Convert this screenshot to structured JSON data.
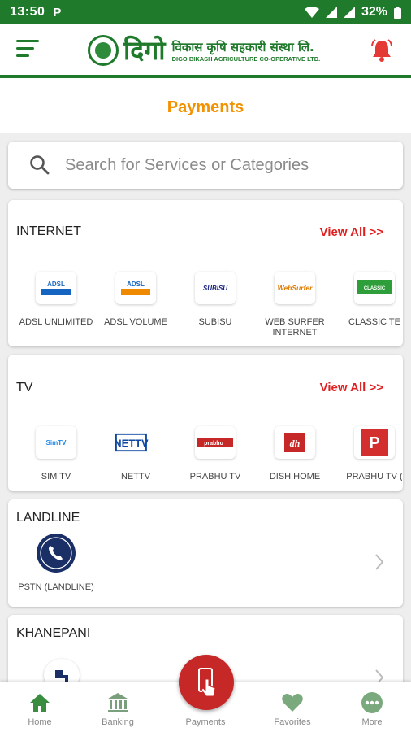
{
  "status_bar": {
    "time": "13:50",
    "app_badge": "P",
    "battery": "32%"
  },
  "header": {
    "logo_big": "दिगो",
    "logo_line1": "विकास कृषि सहकारी संस्था लि.",
    "logo_line2": "DIGO BIKASH AGRICULTURE CO-OPERATIVE LTD."
  },
  "page": {
    "title": "Payments"
  },
  "search": {
    "placeholder": "Search for Services or Categories"
  },
  "sections": {
    "internet": {
      "title": "INTERNET",
      "view_all": "View All >>",
      "items": [
        {
          "label": "ADSL UNLIMITED",
          "logo_text": "ADSL"
        },
        {
          "label": "ADSL VOLUME",
          "logo_text": "ADSL"
        },
        {
          "label": "SUBISU",
          "logo_text": "SUBISU"
        },
        {
          "label": "WEB SURFER\nINTERNET",
          "logo_text": "WebSurfer"
        },
        {
          "label": "CLASSIC TE",
          "logo_text": "CLASSIC"
        }
      ]
    },
    "tv": {
      "title": "TV",
      "view_all": "View All >>",
      "items": [
        {
          "label": "SIM TV",
          "logo_text": "SimTV"
        },
        {
          "label": "NETTV",
          "logo_text": "NETTV"
        },
        {
          "label": "PRABHU TV",
          "logo_text": "prabhu"
        },
        {
          "label": "DISH HOME",
          "logo_text": "dh"
        },
        {
          "label": "PRABHU TV (",
          "logo_text": "P"
        }
      ]
    },
    "landline": {
      "title": "LANDLINE",
      "items": [
        {
          "label": "PSTN (LANDLINE)"
        }
      ]
    },
    "khanepani": {
      "title": "KHANEPANI"
    }
  },
  "bottom_nav": {
    "home": "Home",
    "banking": "Banking",
    "payments": "Payments",
    "favorites": "Favorites",
    "more": "More"
  },
  "colors": {
    "brand_green": "#1f7a2b",
    "accent_orange": "#f39200",
    "alert_red": "#e02020",
    "fab_red": "#c62828"
  }
}
